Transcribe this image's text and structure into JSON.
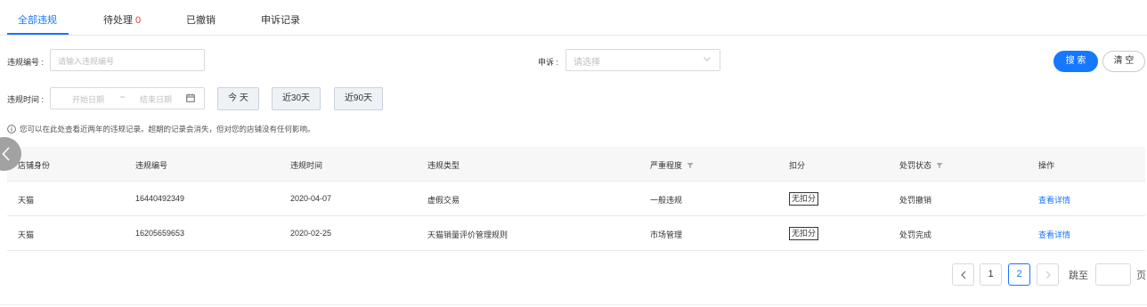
{
  "tabs": [
    {
      "label": "全部违规"
    },
    {
      "label": "待处理",
      "count": "0"
    },
    {
      "label": "已撤销"
    },
    {
      "label": "申诉记录"
    }
  ],
  "filters": {
    "violation_no_label": "违规编号 :",
    "violation_no_placeholder": "请输入违规编号",
    "appeal_label": "申诉 :",
    "appeal_placeholder": "请选择",
    "time_label": "违规时间 :",
    "start_placeholder": "开始日期",
    "range_sep": "~",
    "end_placeholder": "结束日期",
    "quick": [
      "今 天",
      "近30天",
      "近90天"
    ]
  },
  "actions": {
    "search": "搜 索",
    "clear": "清 空"
  },
  "notice": "您可以在此处查看近两年的违规记录。超期的记录会消失，但对您的店铺没有任何影响。",
  "table": {
    "headers": [
      "店铺身份",
      "违规编号",
      "违规时间",
      "违规类型",
      "严重程度",
      "扣分",
      "处罚状态",
      "操作"
    ],
    "rows": [
      [
        "天猫",
        "16440492349",
        "2020-04-07",
        "虚假交易",
        "一般违规",
        "无扣分",
        "处罚撤销",
        "查看详情"
      ],
      [
        "天猫",
        "16205659653",
        "2020-02-25",
        "天猫销量评价管理规则",
        "市场管理",
        "无扣分",
        "处罚完成",
        "查看详情"
      ]
    ]
  },
  "pagination": {
    "pages": [
      "1",
      "2"
    ],
    "current": "2",
    "jump_label": "跳至",
    "page_suffix": "页"
  },
  "colors": {
    "accent": "#1677ff",
    "count": "#e4393c"
  }
}
